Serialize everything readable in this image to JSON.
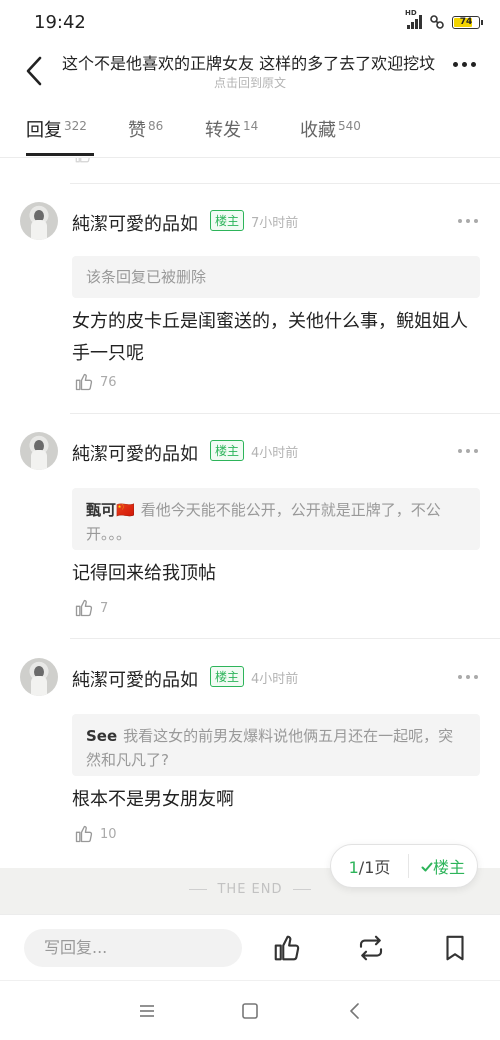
{
  "status": {
    "time": "19:42",
    "battery": "74",
    "network": "HD"
  },
  "header": {
    "title": "这个不是他喜欢的正牌女友 这样的多了去了欢迎挖坟",
    "subtitle": "点击回到原文"
  },
  "tabs": [
    {
      "label": "回复",
      "count": "322"
    },
    {
      "label": "赞",
      "count": "86"
    },
    {
      "label": "转发",
      "count": "14"
    },
    {
      "label": "收藏",
      "count": "540"
    }
  ],
  "replies": [
    {
      "username": "純潔可愛的品如",
      "badge": "楼主",
      "time": "7小时前",
      "quote_name": "",
      "quote_text": "该条回复已被删除",
      "body_line1": "女方的皮卡丘是闺蜜送的，关他什么事，鲵姐姐人",
      "body_line2": "手一只呢",
      "likes": "76"
    },
    {
      "username": "純潔可愛的品如",
      "badge": "楼主",
      "time": "4小时前",
      "quote_name": "甄可🇨🇳",
      "quote_text": "看他今天能不能公开，公开就是正牌了，不公开。。。",
      "body_line1": "记得回来给我顶帖",
      "body_line2": "",
      "likes": "7"
    },
    {
      "username": "純潔可愛的品如",
      "badge": "楼主",
      "time": "4小时前",
      "quote_name": "See",
      "quote_text": "我看这女的前男友爆料说他俩五月还在一起呢，突然和凡凡了?",
      "body_line1": "根本不是男女朋友啊",
      "body_line2": "",
      "likes": "10"
    }
  ],
  "end_text": "THE END",
  "pager": {
    "current": "1",
    "rest": "/1页",
    "filter": "楼主"
  },
  "bottom": {
    "compose_placeholder": "写回复..."
  },
  "colors": {
    "accent": "#2db45a",
    "muted": "#b3b3b3"
  },
  "icons": [
    "back-arrow-icon",
    "more-icon",
    "like-icon",
    "repost-icon",
    "bookmark-icon",
    "menu-icon",
    "home-icon",
    "back-nav-icon"
  ]
}
